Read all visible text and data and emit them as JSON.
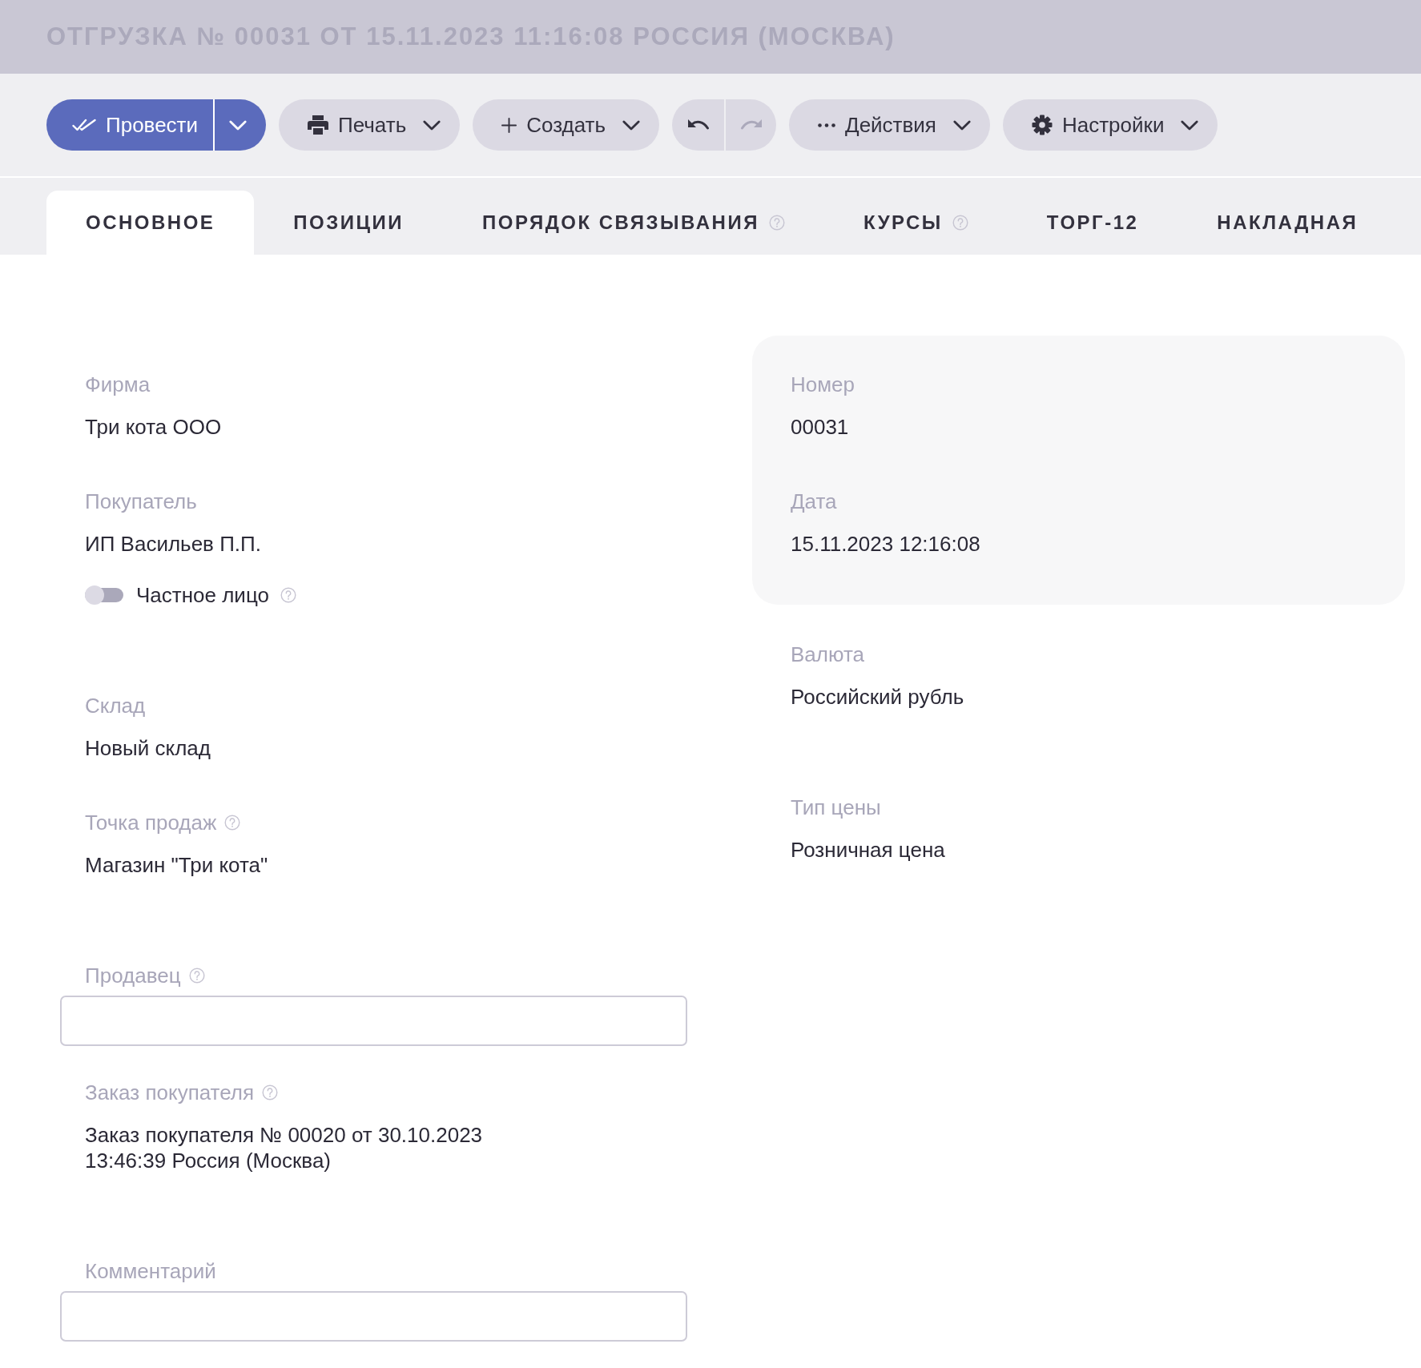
{
  "title": "ОТГРУЗКА № 00031 ОТ 15.11.2023 11:16:08 РОССИЯ (МОСКВА)",
  "toolbar": {
    "buttons": [
      {
        "kind": "split",
        "label": "Провести"
      },
      {
        "kind": "menu",
        "label": "Печать"
      },
      {
        "kind": "menu",
        "label": "Создать"
      },
      {
        "kind": "history",
        "items": [
          {
            "disabled": false
          },
          {
            "disabled": true
          }
        ]
      },
      {
        "kind": "menu",
        "label": "Действия"
      },
      {
        "kind": "menu",
        "label": "Настройки"
      }
    ]
  },
  "tabs": [
    {
      "label": "ОСНОВНОЕ",
      "selected": true,
      "help": false
    },
    {
      "label": "ПОЗИЦИИ",
      "selected": false,
      "help": false
    },
    {
      "label": "ПОРЯДОК СВЯЗЫВАНИЯ",
      "selected": false,
      "help": true
    },
    {
      "label": "КУРСЫ",
      "selected": false,
      "help": true
    },
    {
      "label": "ТОРГ-12",
      "selected": false,
      "help": false
    },
    {
      "label": "НАКЛАДНАЯ",
      "selected": false,
      "help": false
    }
  ],
  "left_column": {
    "groups": [
      {
        "fields": [
          {
            "kind": "text",
            "label": "Фирма",
            "value": "Три кота ООО"
          },
          {
            "kind": "text",
            "label": "Покупатель",
            "value": "ИП Васильев П.П.",
            "toggle": {
              "label": "Частное лицо",
              "on": false,
              "help": true
            }
          }
        ]
      },
      {
        "fields": [
          {
            "kind": "text",
            "label": "Склад",
            "value": "Новый склад"
          },
          {
            "kind": "text",
            "label": "Точка продаж",
            "help": true,
            "value": "Магазин \"Три кота\""
          }
        ]
      },
      {
        "fields": [
          {
            "kind": "input",
            "label": "Продавец",
            "help": true
          },
          {
            "kind": "text",
            "label": "Заказ покупателя",
            "help": true,
            "value": "Заказ покупателя № 00020 от 30.10.2023 13:46:39 Россия (Москва)"
          }
        ]
      },
      {
        "fields": [
          {
            "kind": "input",
            "label": "Комментарий"
          }
        ]
      }
    ]
  },
  "right_column": {
    "card": {
      "fields": [
        {
          "kind": "text",
          "label": "Номер",
          "value": "00031"
        },
        {
          "kind": "text",
          "label": "Дата",
          "value": "15.11.2023 12:16:08"
        }
      ]
    },
    "groups": [
      {
        "fields": [
          {
            "kind": "text",
            "label": "Валюта",
            "value": "Российский рубль"
          }
        ]
      },
      {
        "fields": [
          {
            "kind": "text",
            "label": "Тип цены",
            "value": "Розничная цена"
          }
        ]
      }
    ]
  }
}
